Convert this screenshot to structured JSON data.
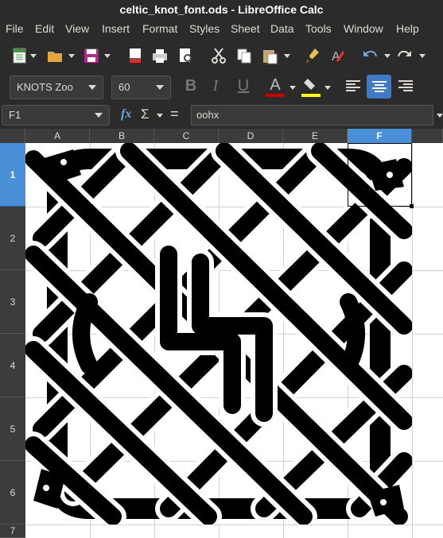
{
  "window": {
    "title": "celtic_knot_font.ods - LibreOffice Calc"
  },
  "menu": [
    "File",
    "Edit",
    "View",
    "Insert",
    "Format",
    "Styles",
    "Sheet",
    "Data",
    "Tools",
    "Window",
    "Help"
  ],
  "toolbar": {
    "font_name": "KNOTS Zoo",
    "font_size": "60",
    "bold_label": "B",
    "italic_label": "I",
    "underline_label": "U",
    "font_color_letter": "A",
    "font_color": "#cc0000",
    "highlight_color": "#ffff00"
  },
  "formula_bar": {
    "cell_ref": "F1",
    "fx_label": "fx",
    "sum_label": "Σ",
    "equals_label": "=",
    "content": "oohx"
  },
  "sheet": {
    "columns": [
      "A",
      "B",
      "C",
      "D",
      "E",
      "F"
    ],
    "rows": [
      "1",
      "2",
      "3",
      "4",
      "5",
      "6",
      "7"
    ],
    "selected_column": "F",
    "selected_row": "1"
  },
  "colors": {
    "chrome_bg": "#2b2b2b",
    "header_bg": "#3c3c3c",
    "selection": "#4a90d9",
    "knot": "#000000"
  }
}
